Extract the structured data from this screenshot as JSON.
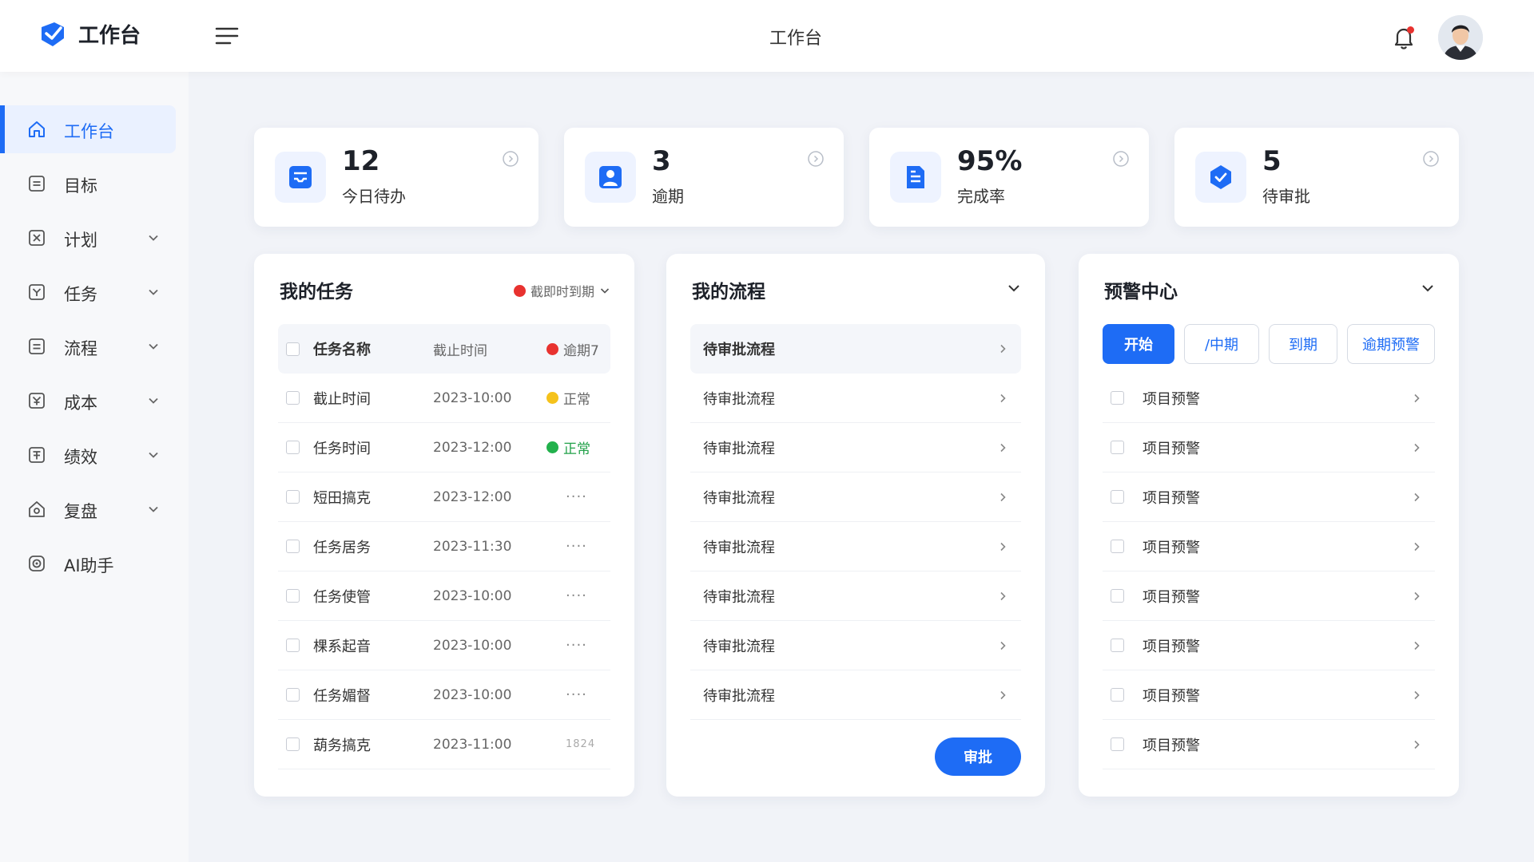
{
  "header": {
    "logo_text": "工作台",
    "title": "工作台"
  },
  "sidebar": {
    "items": [
      {
        "label": "工作台",
        "icon": "home-icon"
      },
      {
        "label": "目标",
        "icon": "target-icon"
      },
      {
        "label": "计划",
        "icon": "plan-icon"
      },
      {
        "label": "任务",
        "icon": "task-icon"
      },
      {
        "label": "流程",
        "icon": "process-icon"
      },
      {
        "label": "成本",
        "icon": "cost-icon"
      },
      {
        "label": "绩效",
        "icon": "performance-icon"
      },
      {
        "label": "复盘",
        "icon": "review-icon"
      },
      {
        "label": "AI助手",
        "icon": "ai-assistant-icon"
      }
    ]
  },
  "stats": [
    {
      "value": "12",
      "label": "今日待办",
      "icon": "inbox-icon"
    },
    {
      "value": "3",
      "label": "逾期",
      "icon": "user-icon"
    },
    {
      "value": "95%",
      "label": "完成率",
      "icon": "document-icon"
    },
    {
      "value": "5",
      "label": "待审批",
      "icon": "shield-icon"
    }
  ],
  "tasks": {
    "title": "我的任务",
    "filter_label": "截即时到期",
    "header": {
      "name": "任务名称",
      "date": "截止时间",
      "status": "逾期7"
    },
    "rows": [
      {
        "name": "截止时间",
        "date": "2023-10:00",
        "status": "正常"
      },
      {
        "name": "任务时间",
        "date": "2023-12:00",
        "status": "正常"
      },
      {
        "name": "短田搞克",
        "date": "2023-12:00",
        "more": "····"
      },
      {
        "name": "任务居务",
        "date": "2023-11:30",
        "more": "····"
      },
      {
        "name": "任务使管",
        "date": "2023-10:00",
        "more": "····"
      },
      {
        "name": "棵系起音",
        "date": "2023-10:00",
        "more": "····"
      },
      {
        "name": "任务媚督",
        "date": "2023-10:00",
        "more": "····"
      },
      {
        "name": "葫务搞克",
        "date": "2023-11:00",
        "more": "1824"
      }
    ]
  },
  "process": {
    "title": "我的流程",
    "rows": [
      "待审批流程",
      "待审批流程",
      "待审批流程",
      "待审批流程",
      "待审批流程",
      "待审批流程",
      "待审批流程",
      "待审批流程"
    ],
    "approve_label": "审批"
  },
  "warnings": {
    "title": "预警中心",
    "segments": [
      "开始",
      "/中期",
      "到期",
      "逾期预警"
    ],
    "rows": [
      "项目预警",
      "项目预警",
      "项目预警",
      "项目预警",
      "项目预警",
      "项目预警",
      "项目预警",
      "项目预警"
    ]
  },
  "colors": {
    "accent": "#1e6cf5",
    "overdue": "#e8322f",
    "warning": "#f5c21b",
    "normal": "#22b14c"
  }
}
